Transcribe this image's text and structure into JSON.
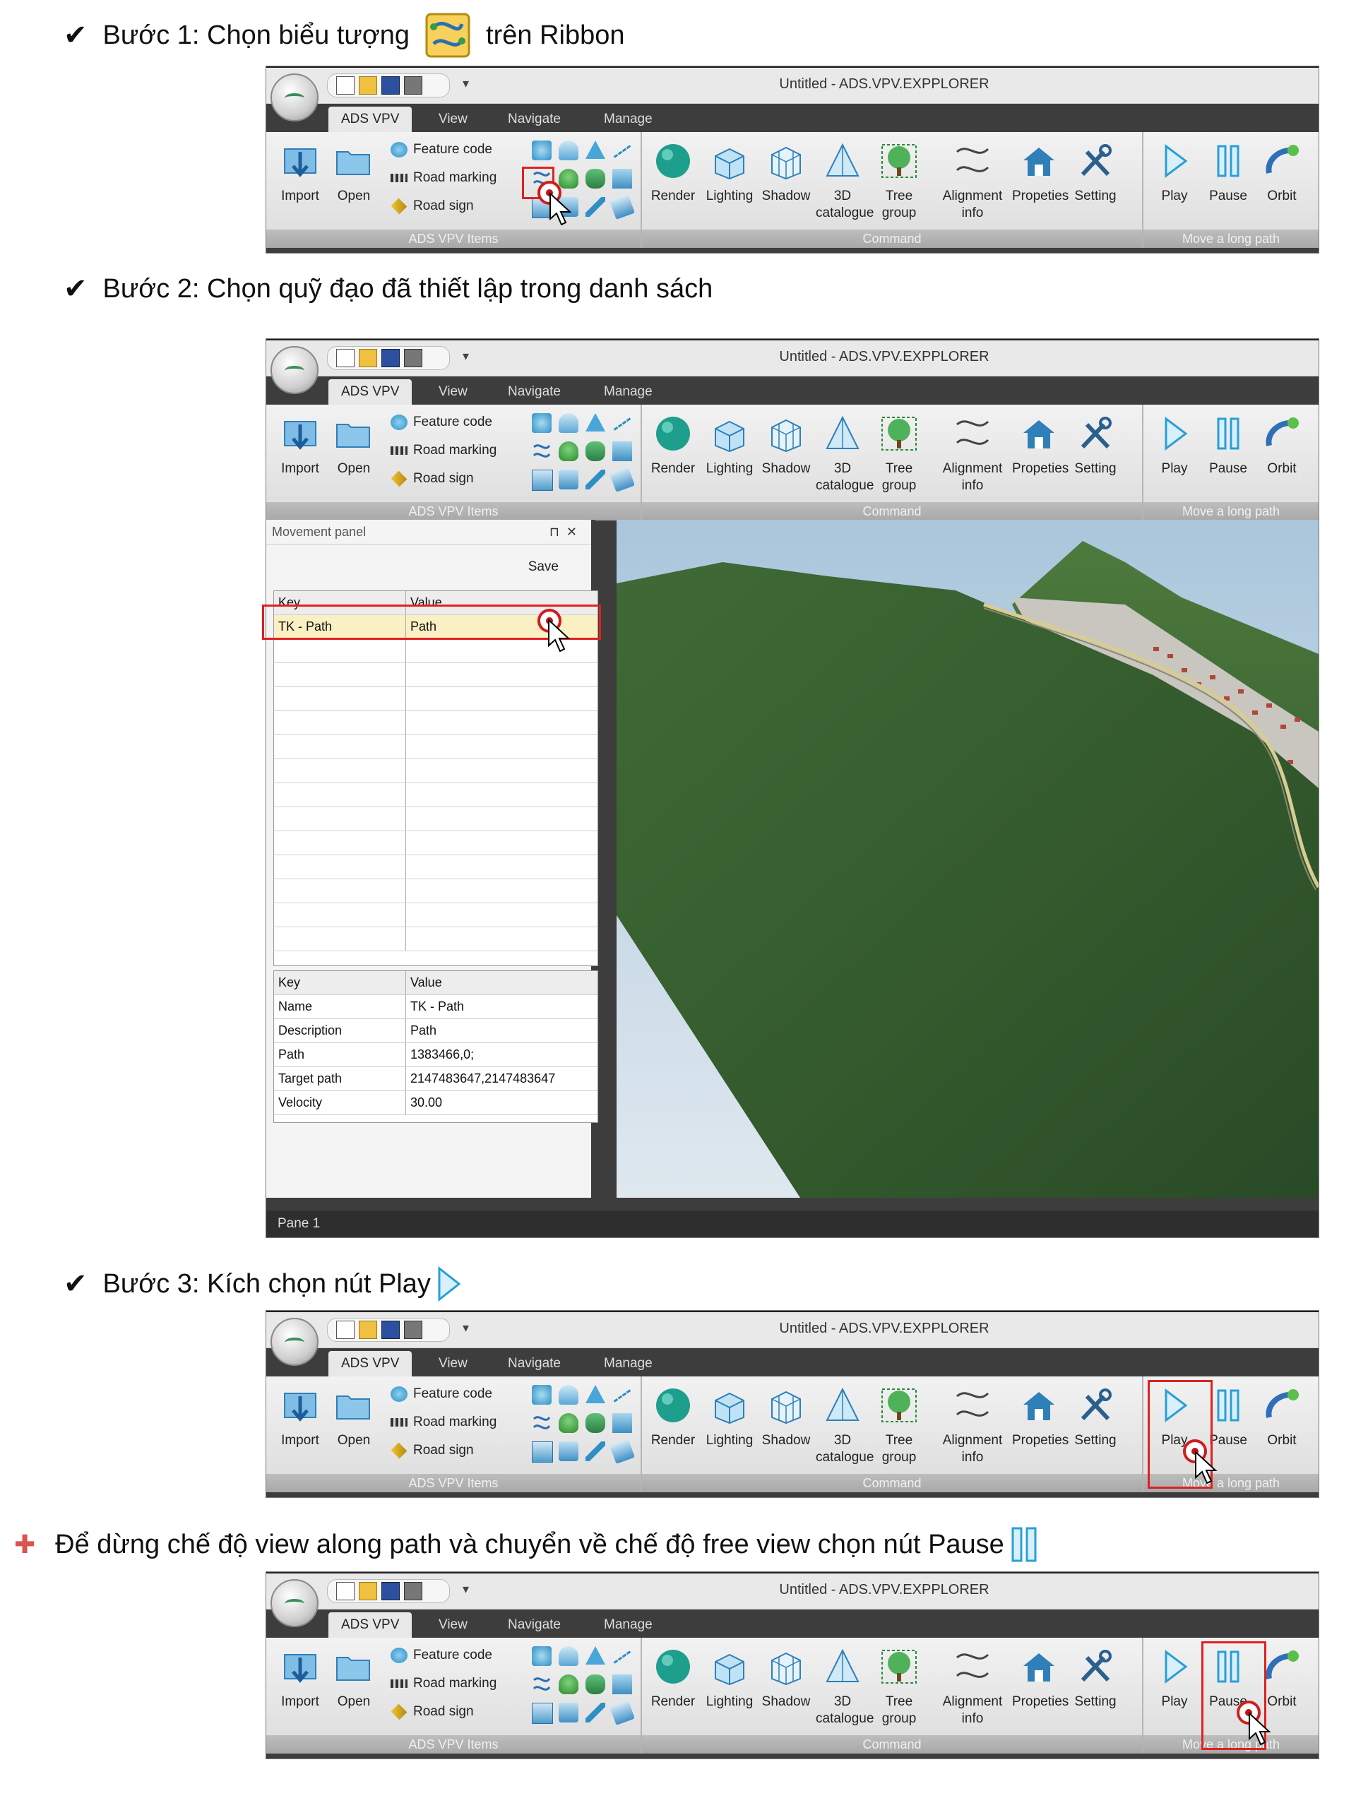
{
  "steps": {
    "s1": "Bước 1: Chọn biểu tượng",
    "s1_after": "trên Ribbon",
    "s2": "Bước 2: Chọn quỹ đạo đã thiết lập trong danh sách",
    "s3": "Bước 3: Kích chọn nút Play",
    "note": "Để dừng chế độ view along path và chuyển về chế độ free view chọn nút Pause"
  },
  "app": {
    "window_title": "Untitled - ADS.VPV.EXPPLORER",
    "tabs": [
      "ADS VPV",
      "View",
      "Navigate",
      "Manage"
    ],
    "groups": {
      "items": "ADS VPV Items",
      "command": "Command",
      "path": "Move a long path"
    },
    "buttons": {
      "import": "Import",
      "open": "Open",
      "feature_code": "Feature code",
      "road_marking": "Road marking",
      "road_sign": "Road sign",
      "render": "Render",
      "lighting": "Lighting",
      "shadow": "Shadow",
      "catalog_1": "3D",
      "catalog_2": "catalogue",
      "tree_1": "Tree",
      "tree_2": "group",
      "align_1": "Alignment",
      "align_2": "info",
      "properties": "Propeties",
      "setting": "Setting",
      "play": "Play",
      "pause": "Pause",
      "orbit": "Orbit"
    }
  },
  "movement_panel": {
    "title": "Movement panel",
    "pin": "⊓",
    "close": "✕",
    "save": "Save",
    "list_header": {
      "key": "Key",
      "value": "Value"
    },
    "list_rows": [
      {
        "key": "TK - Path",
        "value": "Path"
      }
    ],
    "props_header": {
      "key": "Key",
      "value": "Value"
    },
    "props": [
      {
        "key": "Name",
        "value": "TK - Path"
      },
      {
        "key": "Description",
        "value": "Path"
      },
      {
        "key": "Path",
        "value": "1383466,0;"
      },
      {
        "key": "Target path",
        "value": "2147483647,2147483647"
      },
      {
        "key": "Velocity",
        "value": "30.00"
      }
    ],
    "status": "Pane 1"
  },
  "icons": {
    "check": "checkmark-icon",
    "note": "bullet-arrow-icon",
    "path_tool": "path-tool-icon",
    "play": "play-icon",
    "pause": "pause-icon"
  },
  "colors": {
    "highlight": "#e02020",
    "accent": "#3aa0d0",
    "selected_row": "#fbefc4"
  }
}
